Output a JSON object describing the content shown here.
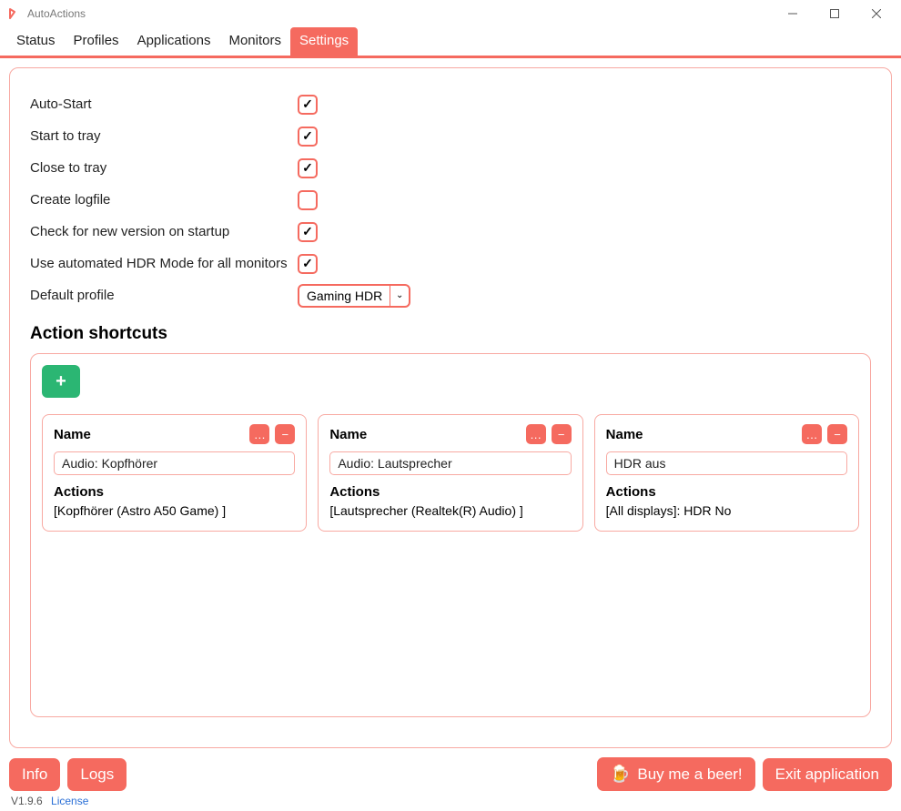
{
  "window": {
    "title": "AutoActions"
  },
  "tabs": [
    "Status",
    "Profiles",
    "Applications",
    "Monitors",
    "Settings"
  ],
  "activeTab": 4,
  "options": [
    {
      "label": "Auto-Start",
      "checked": true
    },
    {
      "label": "Start to tray",
      "checked": true
    },
    {
      "label": "Close to tray",
      "checked": true
    },
    {
      "label": "Create logfile",
      "checked": false
    },
    {
      "label": "Check for new version on startup",
      "checked": true
    },
    {
      "label": "Use automated HDR Mode for all monitors",
      "checked": true
    }
  ],
  "defaultProfile": {
    "label": "Default profile",
    "value": "Gaming HDR"
  },
  "shortcuts": {
    "heading": "Action shortcuts",
    "nameLabel": "Name",
    "actionsLabel": "Actions",
    "editGlyph": "…",
    "removeGlyph": "−",
    "cards": [
      {
        "name": "Audio: Kopfhörer",
        "actions": "[Kopfhörer (Astro A50 Game) ]"
      },
      {
        "name": "Audio: Lautsprecher",
        "actions": "[Lautsprecher (Realtek(R) Audio) ]"
      },
      {
        "name": "HDR aus",
        "actions": "[All displays]: HDR No"
      }
    ]
  },
  "footer": {
    "info": "Info",
    "logs": "Logs",
    "beer": "Buy me a beer!",
    "exit": "Exit application",
    "version": "V1.9.6",
    "license": "License"
  }
}
